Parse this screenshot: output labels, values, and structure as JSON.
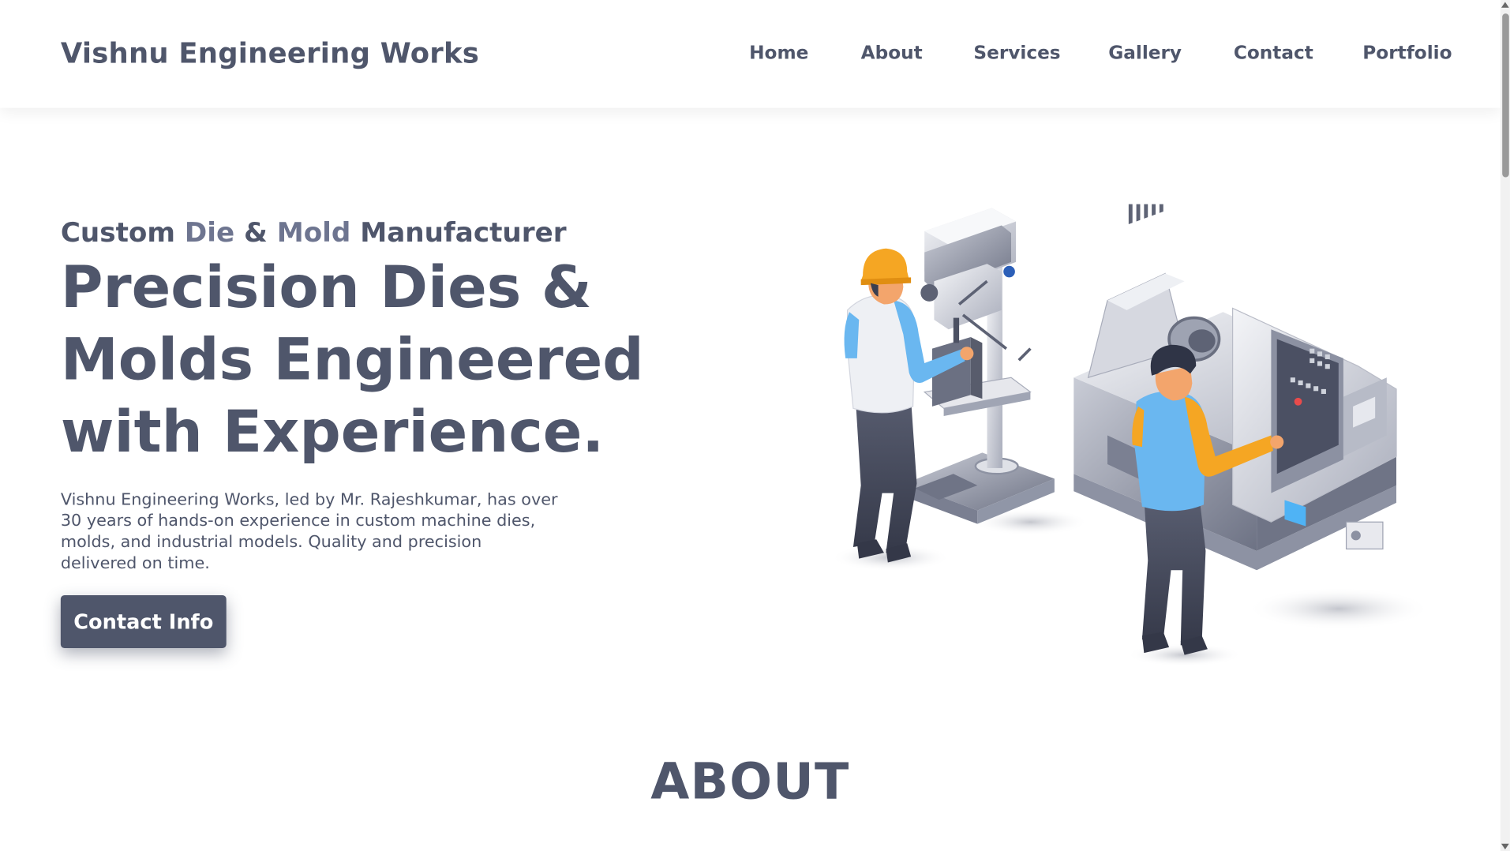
{
  "brand": "Vishnu Engineering Works",
  "nav": [
    {
      "label": "Home"
    },
    {
      "label": "About"
    },
    {
      "label": "Services"
    },
    {
      "label": "Gallery"
    },
    {
      "label": "Contact"
    },
    {
      "label": "Portfolio"
    }
  ],
  "hero": {
    "eyebrow_1": "Custom ",
    "eyebrow_2": "Die",
    "eyebrow_3": " & ",
    "eyebrow_4": "Mold",
    "eyebrow_5": " Manufacturer",
    "headline": "Precision Dies & Molds Engineered with Experience.",
    "description": "Vishnu Engineering Works, led by Mr. Rajeshkumar, has over 30 years of hands-on experience in custom machine dies, molds, and industrial models. Quality and precision delivered on time.",
    "cta_label": "Contact Info"
  },
  "about": {
    "title": "ABOUT"
  },
  "colors": {
    "primary": "#4f566b",
    "accent": "#6e7590",
    "helmet": "#f5a623",
    "shirt": "#6ab7f0"
  },
  "icons": [
    "workers-machinery-illustration"
  ]
}
